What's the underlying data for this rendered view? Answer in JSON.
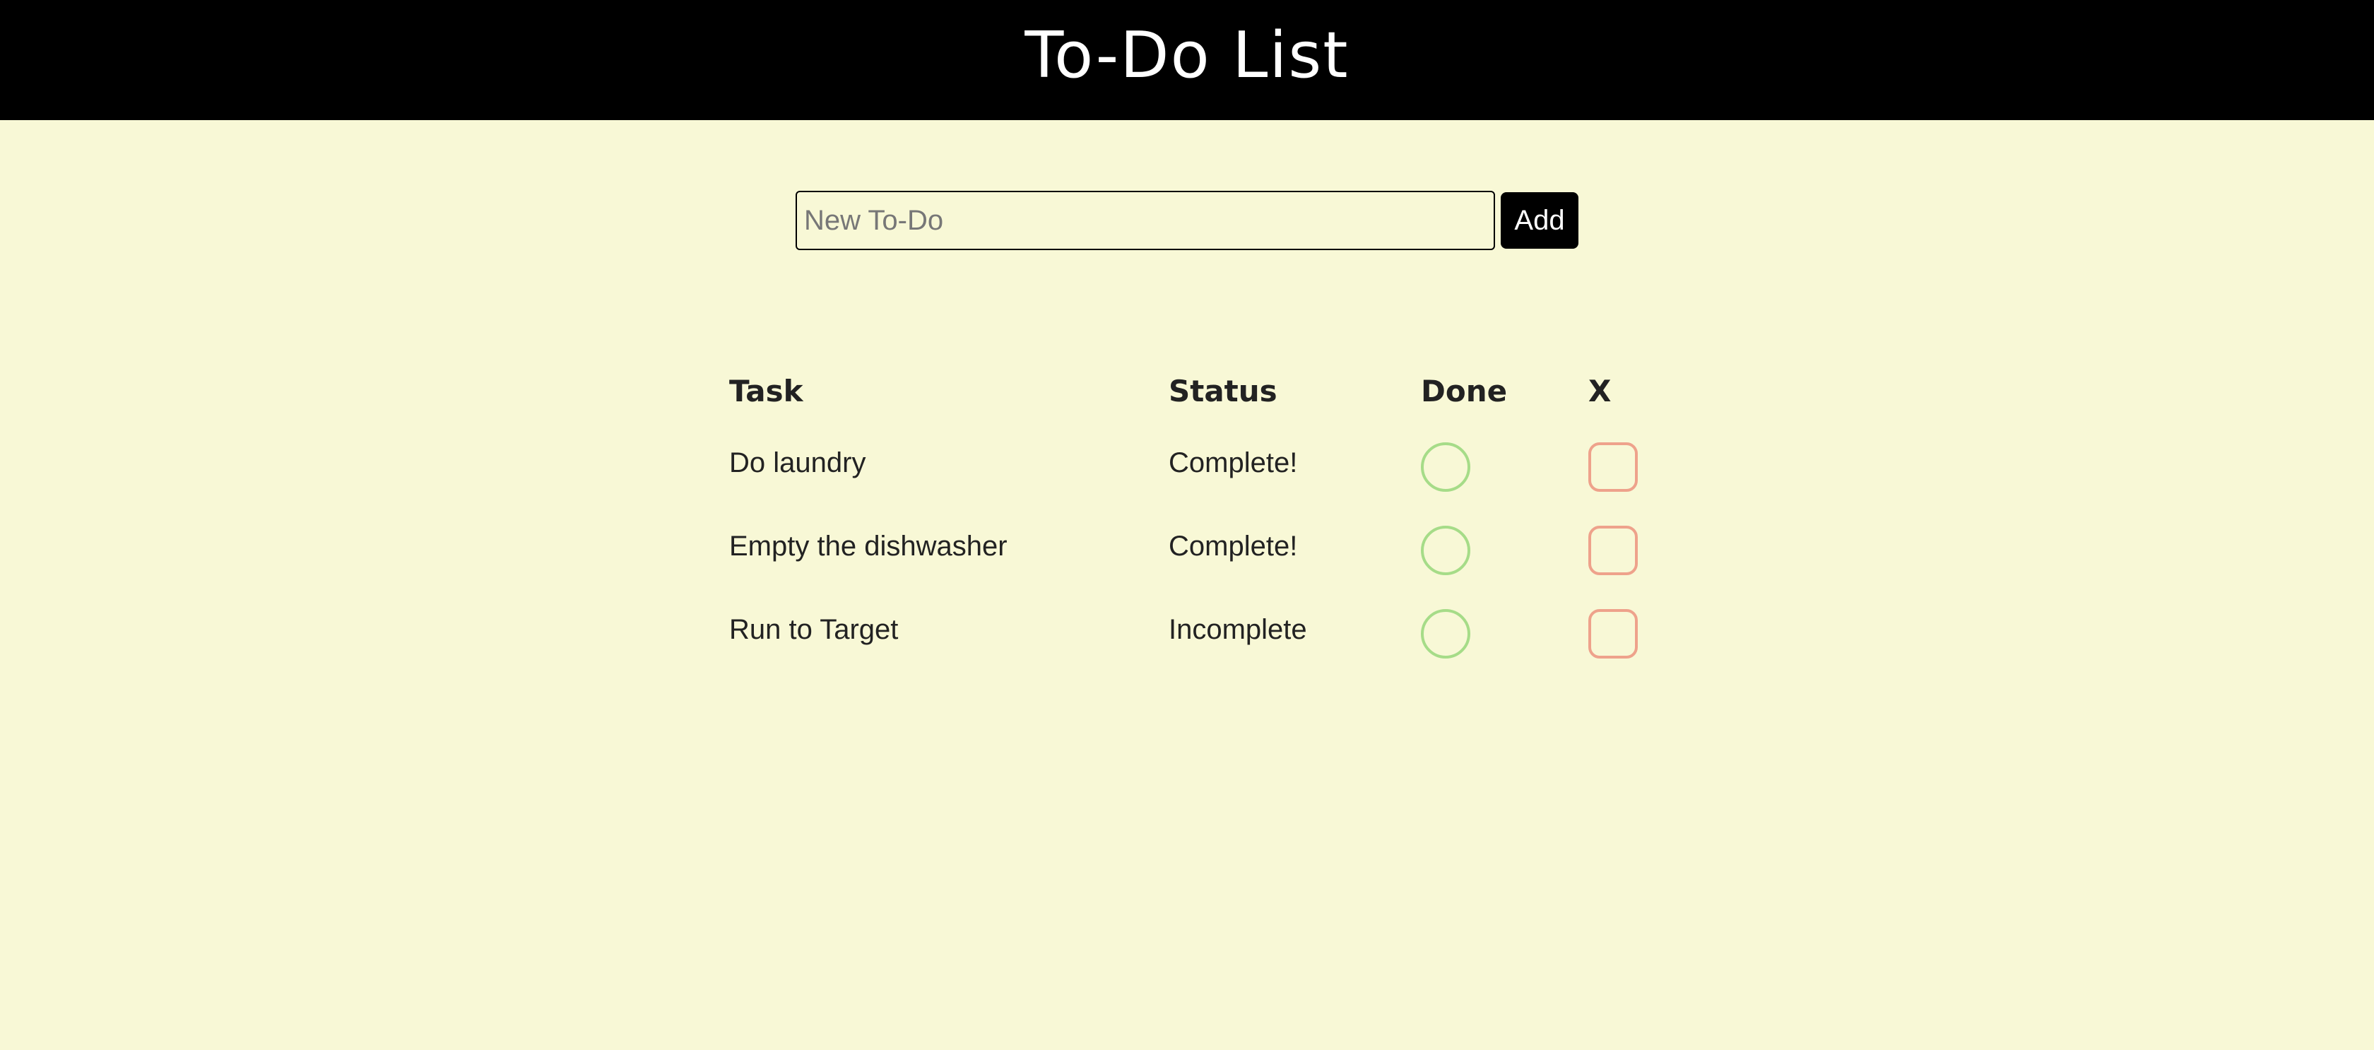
{
  "header": {
    "title": "To-Do List"
  },
  "form": {
    "input_value": "",
    "input_placeholder": "New To-Do",
    "add_label": "Add"
  },
  "table": {
    "columns": {
      "task": "Task",
      "status": "Status",
      "done": "Done",
      "delete": "X"
    },
    "rows": [
      {
        "task": "Do laundry",
        "status": "Complete!"
      },
      {
        "task": "Empty the dishwasher",
        "status": "Complete!"
      },
      {
        "task": "Run to Target",
        "status": "Incomplete"
      }
    ]
  },
  "colors": {
    "background": "#f8f8d6",
    "header": "#000000",
    "done_circle": "#a6dc88",
    "delete_box": "#eea28b"
  }
}
